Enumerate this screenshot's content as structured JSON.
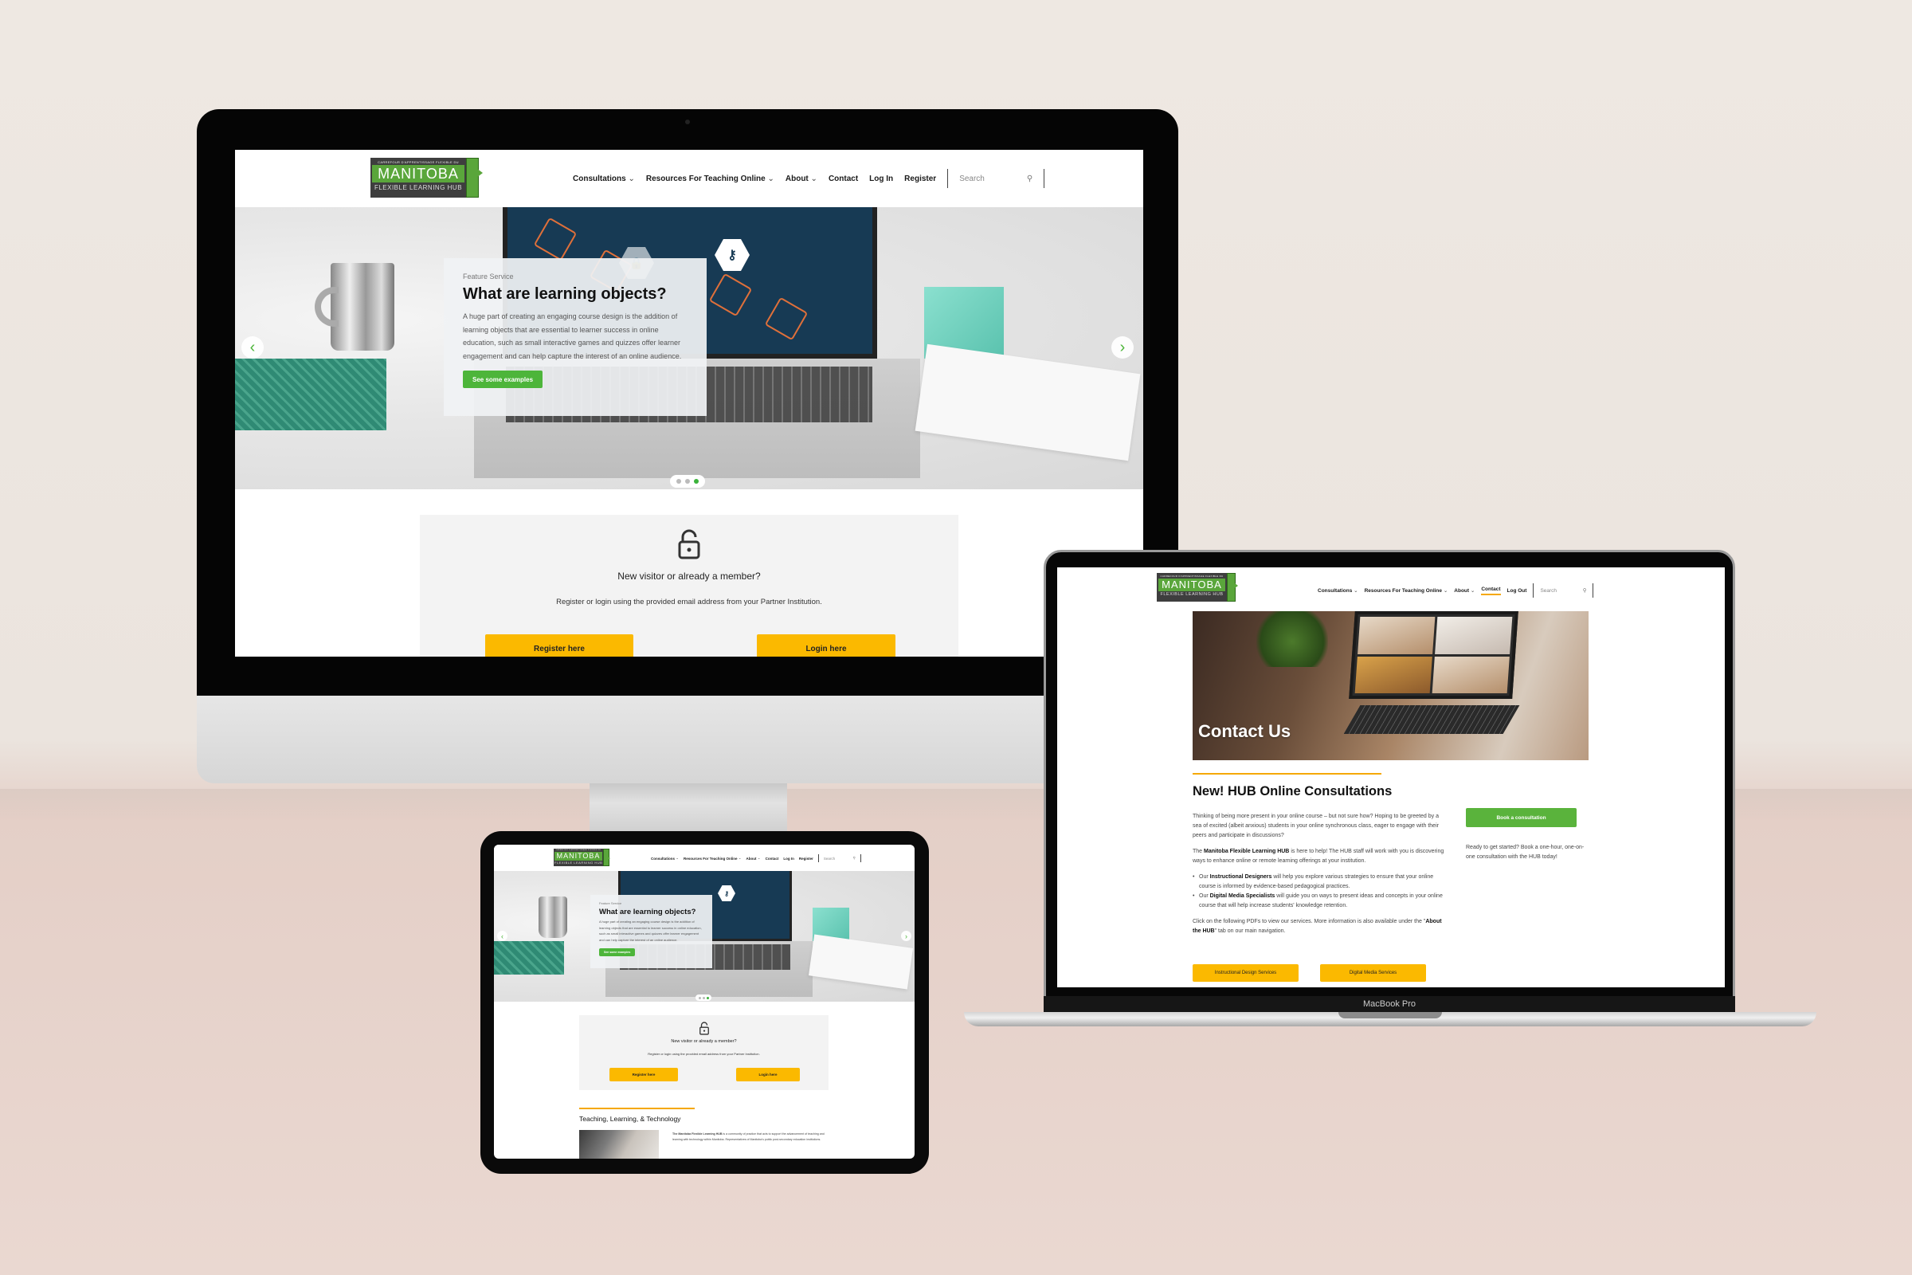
{
  "brand": {
    "logo_top": "CARREFOUR D'APPRENTISSAGE FLEXIBLE DU",
    "logo_main": "MANITOBA",
    "logo_bottom": "FLEXIBLE LEARNING HUB",
    "accent_green": "#5aa63b",
    "accent_yellow": "#fbb900",
    "accent_orange": "#f5a800"
  },
  "desktop": {
    "nav": {
      "items": [
        {
          "label": "Consultations",
          "dropdown": true
        },
        {
          "label": "Resources For Teaching Online",
          "dropdown": true
        },
        {
          "label": "About",
          "dropdown": true
        },
        {
          "label": "Contact",
          "dropdown": false
        },
        {
          "label": "Log In",
          "dropdown": false
        },
        {
          "label": "Register",
          "dropdown": false
        }
      ],
      "search_placeholder": "Search",
      "chevron": "⌄"
    },
    "hero": {
      "eyebrow": "Feature Service",
      "title": "What are learning objects?",
      "body": "A huge part of creating an engaging course design is the addition of learning objects that are essential to learner success in online education, such as small interactive games and quizzes offer learner engagement and can help capture the interest of an online audience.",
      "cta": "See some examples",
      "prev_icon": "‹",
      "next_icon": "›",
      "slides_total": 3,
      "slide_active": 3
    },
    "member": {
      "title": "New visitor or already a member?",
      "subtitle": "Register or login using the provided email address from your Partner Institution.",
      "register": "Register here",
      "login": "Login here"
    }
  },
  "laptop": {
    "device_label": "MacBook Pro",
    "nav": {
      "items": [
        {
          "label": "Consultations",
          "dropdown": true
        },
        {
          "label": "Resources For Teaching Online",
          "dropdown": true
        },
        {
          "label": "About",
          "dropdown": true
        },
        {
          "label": "Contact",
          "dropdown": false,
          "active": true
        },
        {
          "label": "Log Out",
          "dropdown": false
        }
      ],
      "search_placeholder": "Search"
    },
    "hero_title": "Contact Us",
    "section_title": "New! HUB Online Consultations",
    "para1": "Thinking of being more present in your online course – but not sure how? Hoping to be greeted by a sea of excited (albeit anxious) students in your online synchronous class, eager to engage with their peers and participate in discussions?",
    "para2_bold": "Manitoba Flexible Learning HUB",
    "para2_pre": "The ",
    "para2_post": " is here to help! The HUB staff will work with you is discovering ways to enhance online or remote learning offerings at your institution.",
    "bullets": [
      {
        "pre": "Our ",
        "bold": "Instructional Designers",
        "post": " will help you explore various strategies to ensure that your online course is informed by evidence-based pedagogical practices."
      },
      {
        "pre": "Our ",
        "bold": "Digital Media Specialists",
        "post": " will guide you on ways to present ideas and concepts in your online course that will help increase students' knowledge retention."
      }
    ],
    "para3_pre": "Click on the following PDFs to view our services. More information is also available under the \"",
    "para3_bold": "About the HUB",
    "para3_post": "\" tab on our main navigation.",
    "btn_instructional": "Instructional Design Services",
    "btn_digital": "Digital Media Services",
    "btn_book": "Book a consultation",
    "side_note": "Ready to get started? Book a one-hour, one-on-one consultation with the HUB today!"
  },
  "tablet": {
    "section_title": "Teaching, Learning, & Technology",
    "intro_bold": "The Manitoba Flexible Learning HUB",
    "intro_rest": " is a community of practice that acts to support the advancement of teaching and learning with technology within Manitoba. Representatives of Manitoba's public post-secondary education institutions."
  }
}
